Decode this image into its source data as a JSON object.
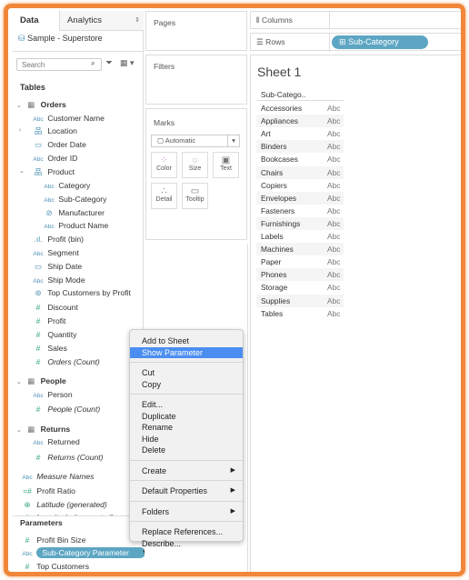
{
  "data_pane": {
    "tabs": [
      "Data",
      "Analytics"
    ],
    "datasource": "Sample - Superstore",
    "search_placeholder": "Search",
    "tables_label": "Tables",
    "items": [
      {
        "label": "Orders",
        "icon": "table-icon",
        "type": "table"
      },
      {
        "label": "Customer Name",
        "icon": "abc-icon"
      },
      {
        "label": "Location",
        "icon": "hierarchy-icon",
        "chev": ">"
      },
      {
        "label": "Order Date",
        "icon": "calendar-icon"
      },
      {
        "label": "Order ID",
        "icon": "abc-icon"
      },
      {
        "label": "Product",
        "icon": "hierarchy-icon",
        "chev": "v"
      },
      {
        "label": "Category",
        "icon": "abc-icon",
        "indent": 1
      },
      {
        "label": "Sub-Category",
        "icon": "abc-icon",
        "indent": 1
      },
      {
        "label": "Manufacturer",
        "icon": "group-icon",
        "indent": 1
      },
      {
        "label": "Product Name",
        "icon": "abc-icon",
        "indent": 1
      },
      {
        "label": "Profit (bin)",
        "icon": "bin-icon"
      },
      {
        "label": "Segment",
        "icon": "abc-icon"
      },
      {
        "label": "Ship Date",
        "icon": "calendar-icon"
      },
      {
        "label": "Ship Mode",
        "icon": "abc-icon"
      },
      {
        "label": "Top Customers by Profit",
        "icon": "set-icon"
      },
      {
        "label": "Discount",
        "icon": "number-icon"
      },
      {
        "label": "Profit",
        "icon": "number-icon"
      },
      {
        "label": "Quantity",
        "icon": "number-icon"
      },
      {
        "label": "Sales",
        "icon": "number-icon"
      },
      {
        "label": "Orders (Count)",
        "icon": "number-icon",
        "italic": true
      },
      {
        "label": "People",
        "icon": "table-icon",
        "type": "table"
      },
      {
        "label": "Person",
        "icon": "abc-icon"
      },
      {
        "label": "People (Count)",
        "icon": "number-icon",
        "italic": true
      },
      {
        "label": "Returns",
        "icon": "table-icon",
        "type": "table"
      },
      {
        "label": "Returned",
        "icon": "abc-icon"
      },
      {
        "label": "Returns (Count)",
        "icon": "number-icon",
        "italic": true
      },
      {
        "label": "Measure Names",
        "icon": "abc-icon",
        "italic": true,
        "level": 0
      },
      {
        "label": "Profit Ratio",
        "icon": "calc-number-icon",
        "level": 0
      },
      {
        "label": "Latitude (generated)",
        "icon": "globe-icon",
        "italic": true,
        "level": 0
      },
      {
        "label": "Longitude (generated)",
        "icon": "globe-icon",
        "italic": true,
        "level": 0
      }
    ],
    "parameters_label": "Parameters",
    "parameters": [
      {
        "label": "Profit Bin Size",
        "icon": "number-icon"
      },
      {
        "label": "Sub-Category Parameter",
        "icon": "abc-icon",
        "selected": true
      },
      {
        "label": "Top Customers",
        "icon": "number-icon"
      }
    ]
  },
  "shelves": {
    "pages": "Pages",
    "filters": "Filters",
    "marks": "Marks",
    "mark_type": "Automatic",
    "mark_buttons": [
      "Color",
      "Size",
      "Text",
      "Detail",
      "Tooltip"
    ],
    "columns": "Columns",
    "rows": "Rows",
    "rows_pill": "Sub-Category"
  },
  "sheet": {
    "title": "Sheet 1",
    "column_header": "Sub-Catego..",
    "cell_value": "Abc",
    "rows": [
      "Accessories",
      "Appliances",
      "Art",
      "Binders",
      "Bookcases",
      "Chairs",
      "Copiers",
      "Envelopes",
      "Fasteners",
      "Furnishings",
      "Labels",
      "Machines",
      "Paper",
      "Phones",
      "Storage",
      "Supplies",
      "Tables"
    ]
  },
  "context_menu": {
    "items": [
      {
        "label": "Add to Sheet"
      },
      {
        "label": "Show Parameter",
        "highlighted": true
      },
      {
        "sep": true
      },
      {
        "label": "Cut"
      },
      {
        "label": "Copy"
      },
      {
        "sep": true
      },
      {
        "label": "Edit..."
      },
      {
        "label": "Duplicate"
      },
      {
        "label": "Rename"
      },
      {
        "label": "Hide"
      },
      {
        "label": "Delete"
      },
      {
        "sep": true
      },
      {
        "label": "Create",
        "submenu": true
      },
      {
        "sep": true
      },
      {
        "label": "Default Properties",
        "submenu": true
      },
      {
        "sep": true
      },
      {
        "label": "Folders",
        "submenu": true
      },
      {
        "sep": true
      },
      {
        "label": "Replace References..."
      },
      {
        "label": "Describe..."
      }
    ]
  },
  "colors": {
    "accent_pill": "#5da6c3",
    "highlight": "#4b8ef1",
    "frame": "#f0873a"
  }
}
